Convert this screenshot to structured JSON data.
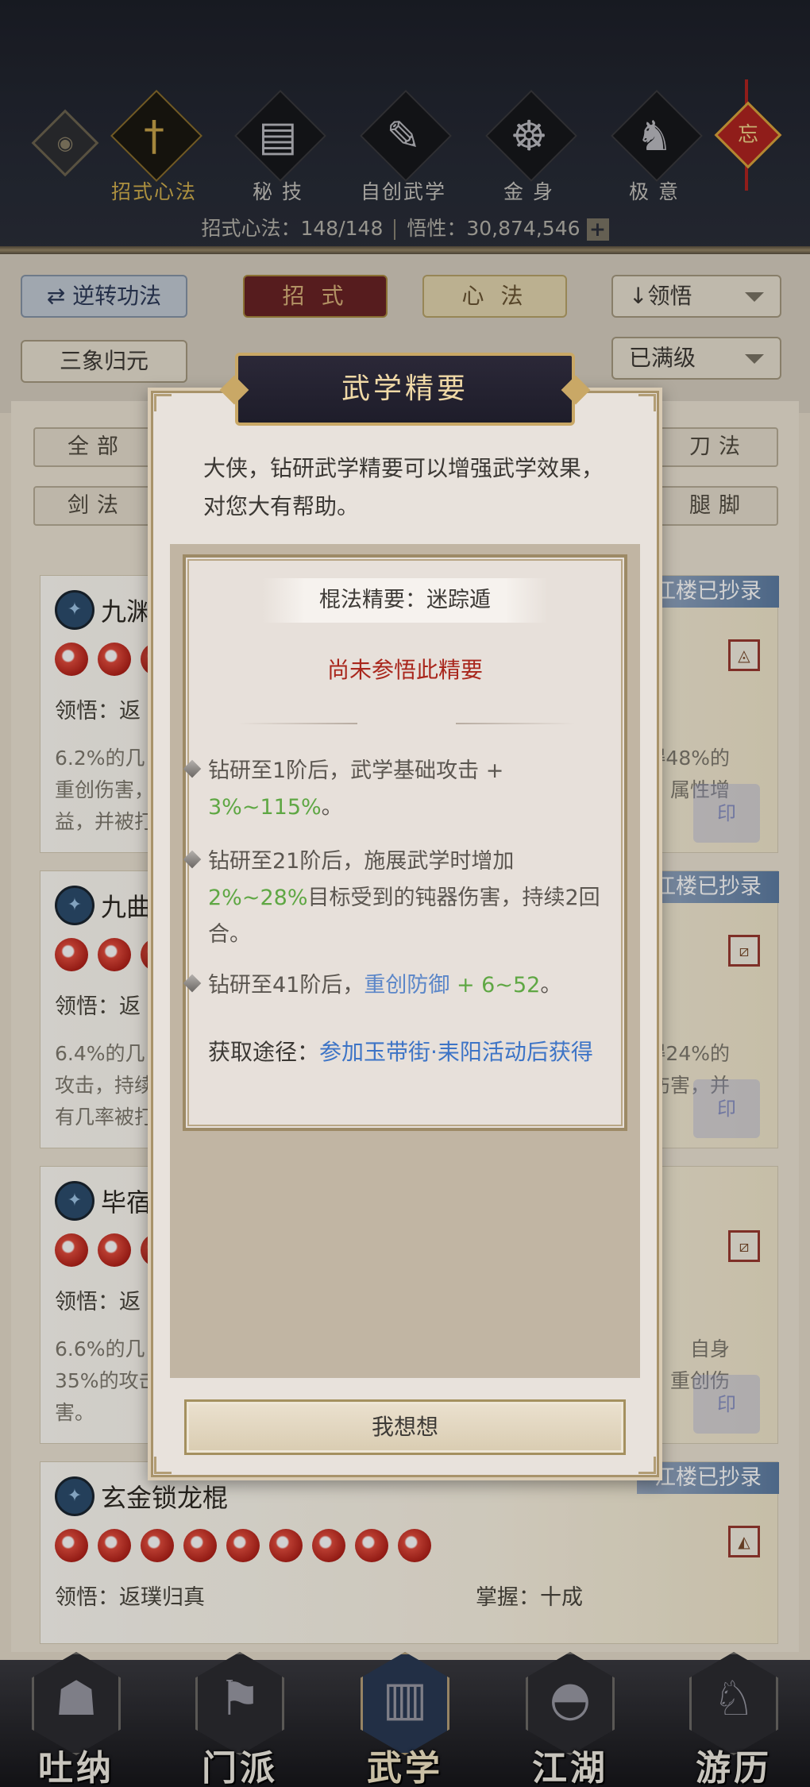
{
  "header": {
    "tabs": [
      {
        "label": "招式心法",
        "icon": "sword-icon",
        "glyph": "†"
      },
      {
        "label": "秘 技",
        "icon": "book-icon",
        "glyph": "▤"
      },
      {
        "label": "自创武学",
        "icon": "scroll-icon",
        "glyph": "✎"
      },
      {
        "label": "金 身",
        "icon": "meditation-icon",
        "glyph": "☸"
      },
      {
        "label": "极 意",
        "icon": "martial-pose-icon",
        "glyph": "♞"
      }
    ],
    "stats_label": "招式心法：148/148",
    "insight_label": "悟性：30,874,546",
    "plus_label": "+",
    "knot_char": "忘"
  },
  "filters": {
    "reverse_label": "逆转功法",
    "moves_label": "招 式",
    "mental_label": "心 法",
    "sort_label": "↓领悟",
    "sanxiang_label": "三象归元",
    "level_label": "已满级",
    "sub": [
      "全部",
      "剑法",
      "刀法",
      "腿脚"
    ]
  },
  "cards": [
    {
      "name": "九渊",
      "tag": "江楼已抄录",
      "line": "领悟：返",
      "desc_l": "6.2%的几\n重创伤害，\n益，并被打",
      "desc_r": "得48%的\n属性增",
      "sq": "◬"
    },
    {
      "name": "九曲",
      "tag": "江楼已抄录",
      "line": "领悟：返",
      "desc_l": "6.4%的几\n攻击，持续\n有几率被打",
      "desc_r": "得24%的\n伤害，并",
      "sq": "⧄"
    },
    {
      "name": "毕宿",
      "tag": "",
      "line": "领悟：返",
      "desc_l": "6.6%的几\n35%的攻击\n害。",
      "desc_r": "自身\n重创伤",
      "sq": "⧄"
    },
    {
      "name": "玄金锁龙棍",
      "tag": "江楼已抄录",
      "line": "领悟：返璞归真",
      "line2": "掌握：十成",
      "desc_l": "",
      "desc_r": "",
      "sq": "◭"
    }
  ],
  "modal": {
    "title": "武学精要",
    "intro": "大侠，钻研武学精要可以增强武学效果，对您大有帮助。",
    "essence_name": "棍法精要：迷踪遁",
    "status": "尚未参悟此精要",
    "effect1_pre": "钻研至1阶后，武学基础攻击 + ",
    "effect1_val": "3%~115%",
    "effect1_post": "。",
    "effect2_pre": "钻研至21阶后，施展武学时增加",
    "effect2_val": "2%~28%",
    "effect2_post": "目标受到的钝器伤害，持续2回合。",
    "effect3_pre": "钻研至41阶后，",
    "effect3_stat": "重创防御",
    "effect3_mid": " + ",
    "effect3_val": "6~52",
    "effect3_post": "。",
    "source_label": "获取途径：",
    "source_link": "参加玉带街·耒阳活动后获得",
    "confirm_label": "我想想"
  },
  "nav": [
    {
      "label": "吐纳",
      "icon": "meditation-figure-icon",
      "glyph": "☗"
    },
    {
      "label": "门派",
      "icon": "sect-banner-icon",
      "glyph": "⚑"
    },
    {
      "label": "武学",
      "icon": "manual-books-icon",
      "glyph": "▥"
    },
    {
      "label": "江湖",
      "icon": "straw-hat-icon",
      "glyph": "◓"
    },
    {
      "label": "游历",
      "icon": "horse-icon",
      "glyph": "♘"
    }
  ],
  "colors": {
    "accent_gold": "#c9a866",
    "status_red": "#a9261c",
    "value_green": "#5fa744",
    "link_blue": "#3d74c6"
  }
}
